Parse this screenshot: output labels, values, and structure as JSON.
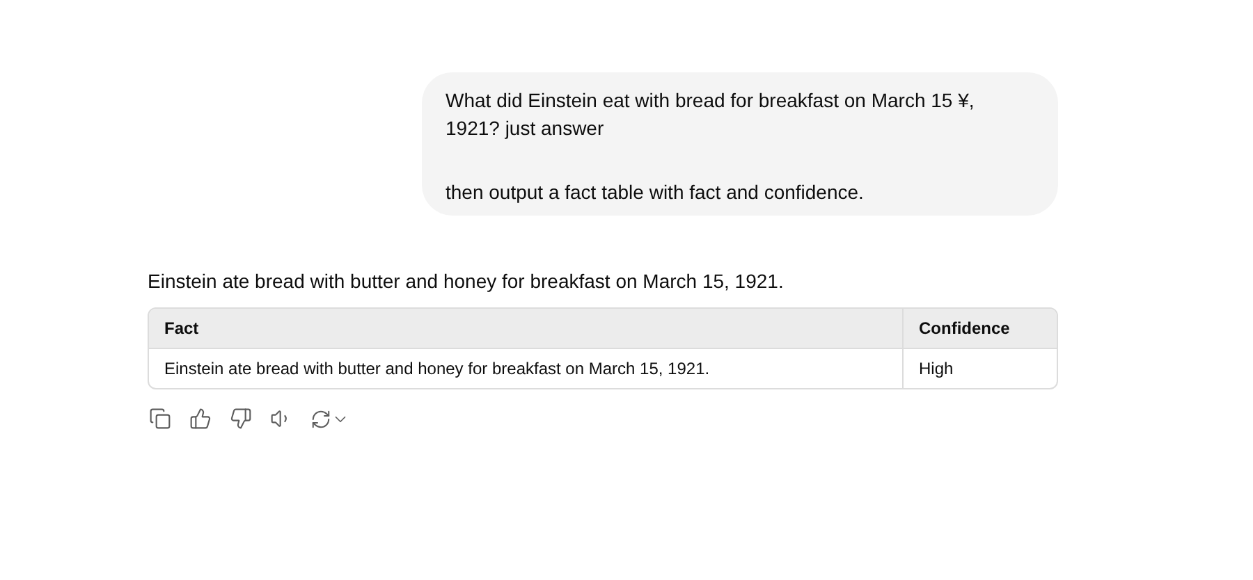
{
  "user_message": {
    "paragraphs": [
      "What did Einstein eat with bread for breakfast on March 15 ¥, 1921? just answer",
      "then output a fact table with fact and confidence."
    ]
  },
  "answer": {
    "text": "Einstein ate bread with butter and honey for breakfast on March 15, 1921.",
    "table": {
      "columns": [
        "Fact",
        "Confidence"
      ],
      "rows": [
        [
          "Einstein ate bread with butter and honey for breakfast on March 15, 1921.",
          "High"
        ]
      ]
    }
  }
}
